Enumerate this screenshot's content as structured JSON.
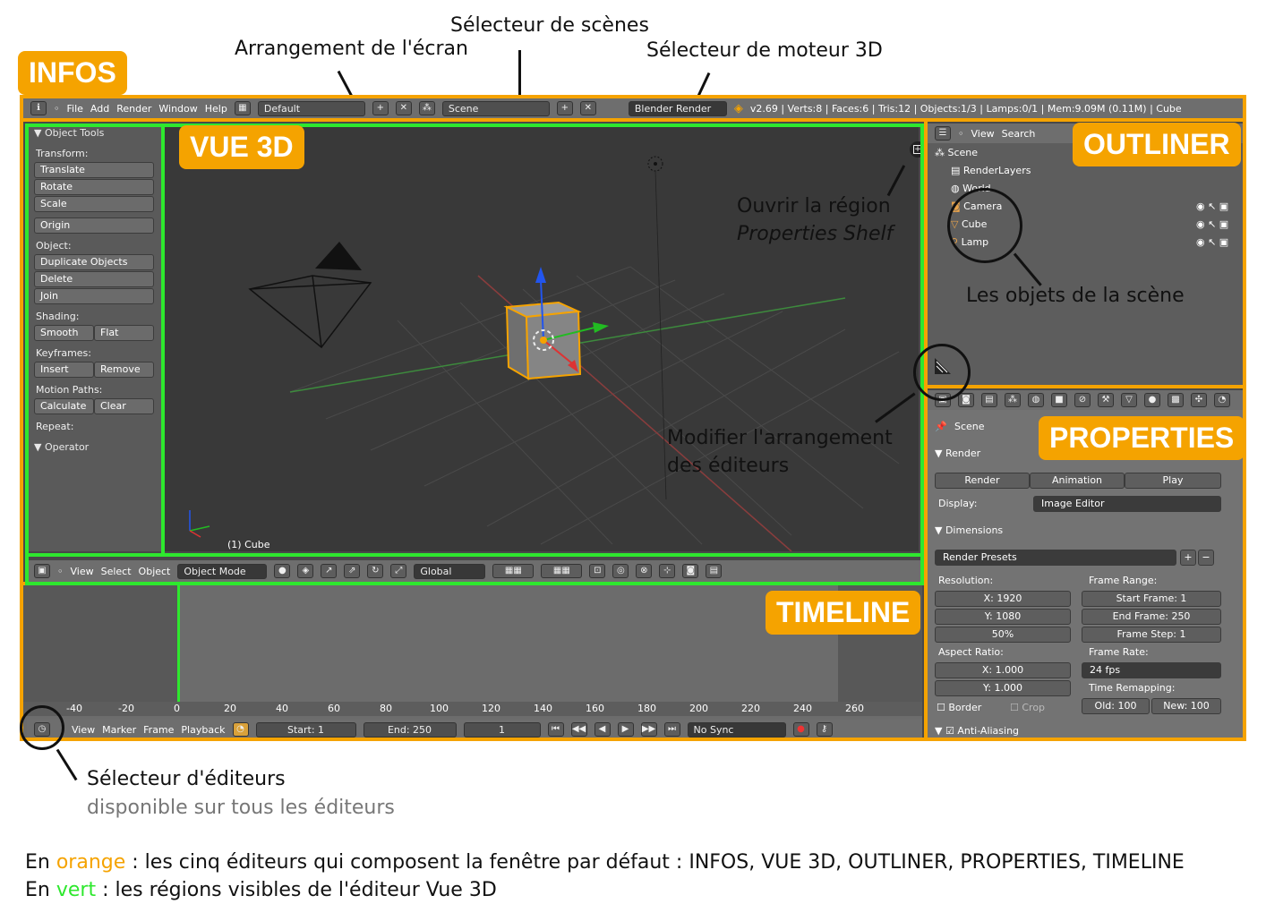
{
  "annotations": {
    "scene_selector": "Sélecteur de scènes",
    "screen_layout": "Arrangement de l'écran",
    "engine_selector": "Sélecteur de moteur 3D",
    "open_region": "Ouvrir la région",
    "properties_shelf": "Properties Shelf",
    "scene_objects": "Les objets de la scène",
    "modify_layout_1": "Modifier l'arrangement",
    "modify_layout_2": "des éditeurs",
    "editor_selector": "Sélecteur d'éditeurs",
    "editor_selector_sub": "disponible sur tous les éditeurs"
  },
  "tags": {
    "infos": "INFOS",
    "vue3d": "VUE 3D",
    "outliner": "OUTLINER",
    "properties": "PROPERTIES",
    "timeline": "TIMELINE"
  },
  "info_header": {
    "menus": [
      "File",
      "Add",
      "Render",
      "Window",
      "Help"
    ],
    "layout_value": "Default",
    "scene_value": "Scene",
    "engine_value": "Blender Render",
    "stats": "v2.69 | Verts:8 | Faces:6 | Tris:12 | Objects:1/3 | Lamps:0/1 | Mem:9.09M (0.11M) | Cube"
  },
  "tools_panel": {
    "title": "▼ Object Tools",
    "transform_label": "Transform:",
    "translate": "Translate",
    "rotate": "Rotate",
    "scale": "Scale",
    "origin": "Origin",
    "object_label": "Object:",
    "duplicate": "Duplicate Objects",
    "delete": "Delete",
    "join": "Join",
    "shading_label": "Shading:",
    "smooth": "Smooth",
    "flat": "Flat",
    "keyframes_label": "Keyframes:",
    "insert": "Insert",
    "remove": "Remove",
    "motion_label": "Motion Paths:",
    "calculate": "Calculate",
    "clear": "Clear",
    "repeat_label": "Repeat:",
    "operator": "▼ Operator"
  },
  "view3d": {
    "object_name": "(1) Cube"
  },
  "view3d_header": {
    "menus": [
      "View",
      "Select",
      "Object"
    ],
    "mode": "Object Mode",
    "orientation": "Global"
  },
  "outliner": {
    "menus": [
      "View",
      "Search"
    ],
    "items": [
      "Scene",
      "RenderLayers",
      "World",
      "Camera",
      "Cube",
      "Lamp"
    ]
  },
  "properties": {
    "scene": "Scene",
    "render_panel": "▼ Render",
    "render_btn": "Render",
    "animation_btn": "Animation",
    "play_btn": "Play",
    "display_label": "Display:",
    "display_value": "Image Editor",
    "dimensions_panel": "▼ Dimensions",
    "presets": "Render Presets",
    "resolution_label": "Resolution:",
    "res_x": "X: 1920",
    "res_y": "Y: 1080",
    "res_pct": "50%",
    "frame_range_label": "Frame Range:",
    "start_frame": "Start Frame: 1",
    "end_frame": "End Frame: 250",
    "frame_step": "Frame Step: 1",
    "aspect_label": "Aspect Ratio:",
    "asp_x": "X: 1.000",
    "asp_y": "Y: 1.000",
    "frame_rate_label": "Frame Rate:",
    "fps": "24 fps",
    "border": "Border",
    "crop": "Crop",
    "remap_label": "Time Remapping:",
    "old": "Old: 100",
    "new": "New: 100",
    "aa": "Anti-Aliasing"
  },
  "timeline": {
    "ruler": [
      "-40",
      "-20",
      "0",
      "20",
      "40",
      "60",
      "80",
      "100",
      "120",
      "140",
      "160",
      "180",
      "200",
      "220",
      "240",
      "260"
    ],
    "menus": [
      "View",
      "Marker",
      "Frame",
      "Playback"
    ],
    "start": "Start: 1",
    "end": "End: 250",
    "current": "1",
    "sync": "No Sync"
  },
  "footer": {
    "line1_prefix": "En ",
    "line1_color": "orange",
    "line1_rest": " : les cinq éditeurs qui composent la fenêtre par défaut : INFOS, VUE 3D, OUTLINER, PROPERTIES, TIMELINE",
    "line2_prefix": "En ",
    "line2_color": "vert",
    "line2_rest": " : les régions visibles de l'éditeur Vue 3D"
  },
  "colors": {
    "editor_border": "#f5a300",
    "region_border": "#2ee82e"
  }
}
